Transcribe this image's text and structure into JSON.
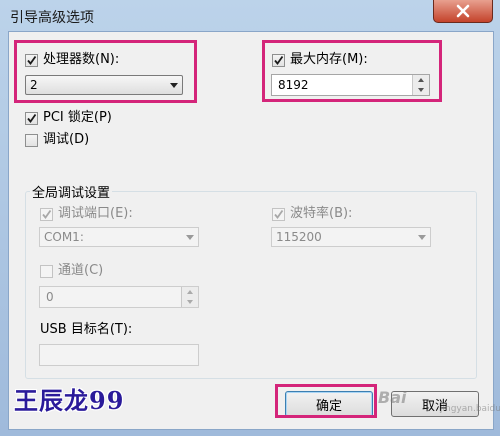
{
  "window": {
    "title": "引导高级选项"
  },
  "processors": {
    "label": "处理器数(N):",
    "checked": true,
    "value": "2"
  },
  "max_memory": {
    "label": "最大内存(M):",
    "checked": true,
    "value": "8192"
  },
  "pci_lock": {
    "label": "PCI 锁定(P)",
    "checked": true
  },
  "debug": {
    "label": "调试(D)",
    "checked": false
  },
  "global_debug": {
    "title": "全局调试设置",
    "debug_port": {
      "label": "调试端口(E):",
      "value": "COM1:"
    },
    "baud_rate": {
      "label": "波特率(B):",
      "value": "115200"
    },
    "channel": {
      "label": "通道(C)",
      "value": "0"
    },
    "usb_target": {
      "label": "USB 目标名(T):",
      "value": ""
    }
  },
  "buttons": {
    "ok": "确定",
    "cancel": "取消"
  },
  "watermark": {
    "text": "王辰龙99",
    "site": "Bai",
    "site_sub": "jingyan.baidu.com"
  },
  "colors": {
    "highlight": "#d4257a",
    "titlebar": "#bcd3ea"
  }
}
